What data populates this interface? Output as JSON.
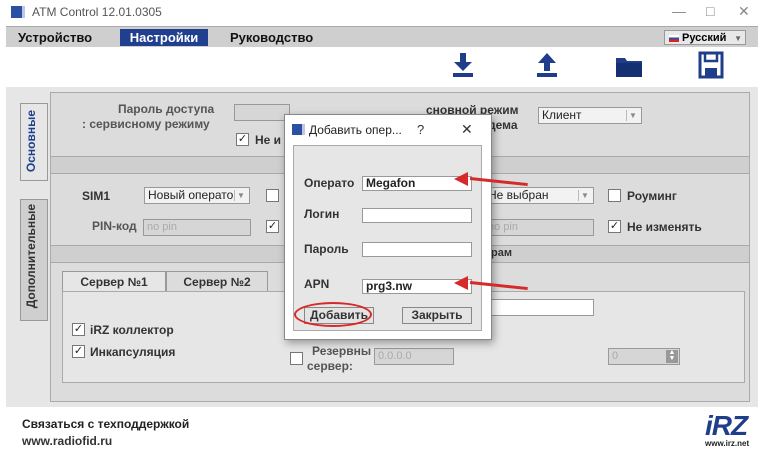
{
  "window": {
    "title": "ATM Control 12.01.0305",
    "minimize": "—",
    "maximize": "□",
    "close": "✕"
  },
  "menu": {
    "items": [
      {
        "label": "Устройство"
      },
      {
        "label": "Настройки"
      },
      {
        "label": "Руководство"
      }
    ],
    "language": "Русский",
    "language_arrow": "▼"
  },
  "toolbar": {
    "icons": [
      "download-icon",
      "upload-icon",
      "folder-icon",
      "save-icon"
    ]
  },
  "side_tabs": {
    "basic": "Основные",
    "advanced": "Дополнительные"
  },
  "basic": {
    "password_label_line1": "Пароль доступа",
    "password_label_line2": ": сервисному режиму",
    "no_change_label_partial": "Не и",
    "mode_label_line1": "сновной режим",
    "mode_label_line2": "дема",
    "mode_value": "Клиент",
    "sim_label": "SIM1",
    "sim_value": "Новый операто",
    "pin_label": "PIN-код",
    "pin_placeholder": "no pin",
    "not_selected": "Не выбран",
    "roaming_label": "Роуминг",
    "pin2_placeholder": "no pin",
    "do_not_change": "Не изменять",
    "servers_bar_partial": "рам"
  },
  "servers": {
    "tabs": [
      {
        "label": "Сервер №1"
      },
      {
        "label": "Сервер №2"
      }
    ],
    "irz_collector": "iRZ коллектор",
    "encapsulation": "Инкапсуляция",
    "backup_server_line1": "Резервны",
    "backup_server_line2": "сервер:",
    "backup_ip": "0.0.0.0",
    "port_value": "0"
  },
  "footer": {
    "support": "Связаться с техподдержкой",
    "site": "www.radiofid.ru",
    "logo_text": "iRZ",
    "logo_site": "www.irz.net"
  },
  "dialog": {
    "title": "Добавить опер...",
    "help": "?",
    "close": "✕",
    "operator_label": "Операто",
    "operator_value": "Megafon",
    "login_label": "Логин",
    "login_value": "",
    "password_label": "Пароль",
    "password_value": "",
    "apn_label": "APN",
    "apn_value": "prg3.nw",
    "add_button": "Добавить",
    "close_button": "Закрыть"
  },
  "colors": {
    "accent": "#20408f",
    "annotation": "#d62a2a"
  }
}
